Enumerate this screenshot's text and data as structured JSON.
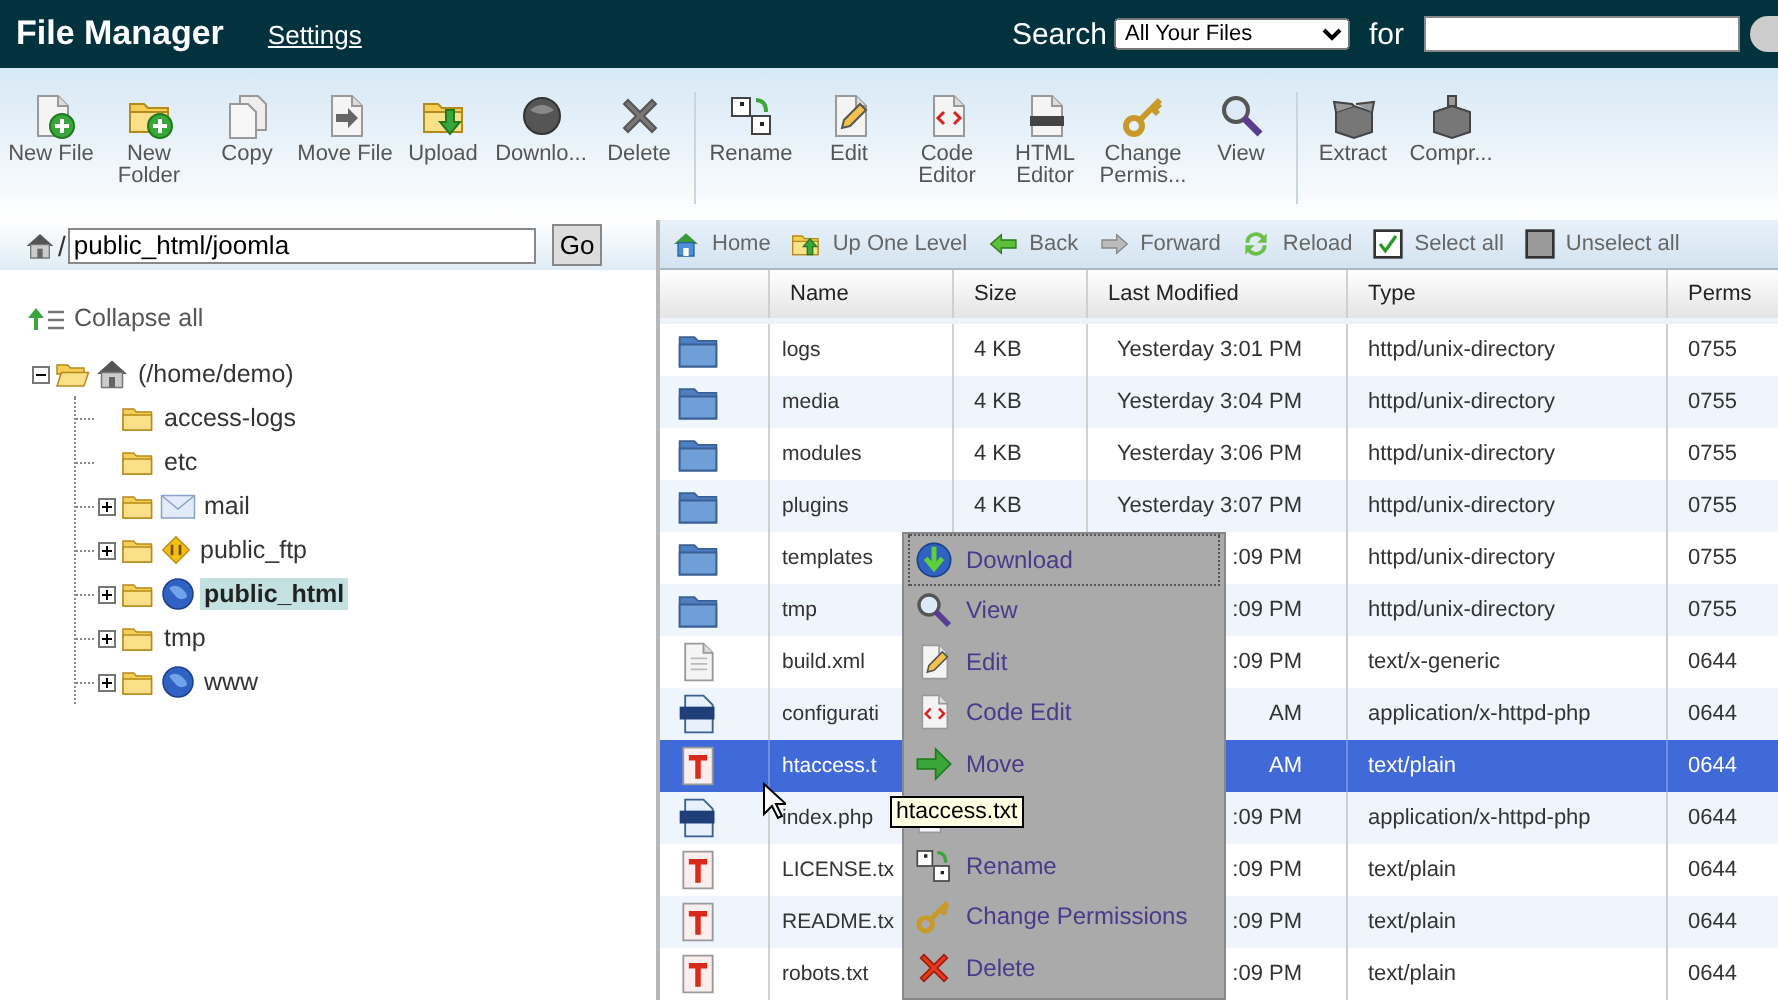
{
  "header": {
    "title": "File Manager",
    "settings_link": "Settings",
    "search_label": "Search",
    "search_scope": "All Your Files",
    "for_label": "for"
  },
  "toolbar": {
    "groups": [
      [
        {
          "label": "New File",
          "kind": "newfile"
        },
        {
          "label": "New Folder",
          "kind": "newfolder"
        },
        {
          "label": "Copy",
          "kind": "copy"
        },
        {
          "label": "Move File",
          "kind": "move"
        },
        {
          "label": "Upload",
          "kind": "upload"
        },
        {
          "label": "Downlo...",
          "kind": "download"
        },
        {
          "label": "Delete",
          "kind": "delete"
        }
      ],
      [
        {
          "label": "Rename",
          "kind": "rename"
        },
        {
          "label": "Edit",
          "kind": "edit"
        },
        {
          "label": "Code Editor",
          "kind": "code"
        },
        {
          "label": "HTML Editor",
          "kind": "html"
        },
        {
          "label": "Change Permis...",
          "kind": "key"
        },
        {
          "label": "View",
          "kind": "search"
        }
      ],
      [
        {
          "label": "Extract",
          "kind": "extract"
        },
        {
          "label": "Compr...",
          "kind": "compress"
        }
      ]
    ]
  },
  "location": {
    "root": "/",
    "path": "public_html/joomla",
    "go": "Go"
  },
  "tree": {
    "collapse_all": "Collapse all",
    "nodes": [
      {
        "label": "(/home/demo)",
        "kind": "home",
        "expanded": true,
        "selected": false,
        "children": [
          {
            "label": "access-logs",
            "kind": "folder",
            "selected": false
          },
          {
            "label": "etc",
            "kind": "folder",
            "selected": false
          },
          {
            "label": "mail",
            "kind": "mail",
            "expanded": false,
            "selected": false
          },
          {
            "label": "public_ftp",
            "kind": "ftp",
            "expanded": false,
            "selected": false
          },
          {
            "label": "public_html",
            "kind": "web",
            "expanded": false,
            "selected": true
          },
          {
            "label": "tmp",
            "kind": "folder",
            "expanded": false,
            "selected": false
          },
          {
            "label": "www",
            "kind": "web",
            "expanded": false,
            "selected": false
          }
        ]
      }
    ]
  },
  "nav": [
    {
      "label": "Home",
      "kind": "home"
    },
    {
      "label": "Up One Level",
      "kind": "up"
    },
    {
      "label": "Back",
      "kind": "back"
    },
    {
      "label": "Forward",
      "kind": "forward"
    },
    {
      "label": "Reload",
      "kind": "reload"
    },
    {
      "label": "Select all",
      "kind": "check"
    },
    {
      "label": "Unselect all",
      "kind": "uncheck"
    }
  ],
  "table": {
    "columns": [
      "Name",
      "Size",
      "Last Modified",
      "Type",
      "Perms"
    ],
    "rows": [
      {
        "kind": "folder",
        "name": "logs",
        "size": "4 KB",
        "modified": "Yesterday 3:01 PM",
        "type": "httpd/unix-directory",
        "perms": "0755",
        "selected": false
      },
      {
        "kind": "folder",
        "name": "media",
        "size": "4 KB",
        "modified": "Yesterday 3:04 PM",
        "type": "httpd/unix-directory",
        "perms": "0755",
        "selected": false
      },
      {
        "kind": "folder",
        "name": "modules",
        "size": "4 KB",
        "modified": "Yesterday 3:06 PM",
        "type": "httpd/unix-directory",
        "perms": "0755",
        "selected": false
      },
      {
        "kind": "folder",
        "name": "plugins",
        "size": "4 KB",
        "modified": "Yesterday 3:07 PM",
        "type": "httpd/unix-directory",
        "perms": "0755",
        "selected": false
      },
      {
        "kind": "folder",
        "name": "templates",
        "modified": ":09 PM",
        "type": "httpd/unix-directory",
        "perms": "0755",
        "selected": false
      },
      {
        "kind": "folder",
        "name": "tmp",
        "modified": ":09 PM",
        "type": "httpd/unix-directory",
        "perms": "0755",
        "selected": false
      },
      {
        "kind": "generic",
        "name": "build.xml",
        "modified": ":09 PM",
        "type": "text/x-generic",
        "perms": "0644",
        "selected": false
      },
      {
        "kind": "php",
        "name": "configurati",
        "modified": "AM",
        "type": "application/x-httpd-php",
        "perms": "0644",
        "selected": false
      },
      {
        "kind": "text",
        "name": "htaccess.t",
        "modified": "AM",
        "type": "text/plain",
        "perms": "0644",
        "selected": true
      },
      {
        "kind": "php",
        "name": "index.php",
        "modified": ":09 PM",
        "type": "application/x-httpd-php",
        "perms": "0644",
        "selected": false
      },
      {
        "kind": "text",
        "name": "LICENSE.tx",
        "modified": ":09 PM",
        "type": "text/plain",
        "perms": "0644",
        "selected": false
      },
      {
        "kind": "text",
        "name": "README.tx",
        "modified": ":09 PM",
        "type": "text/plain",
        "perms": "0644",
        "selected": false
      },
      {
        "kind": "text",
        "name": "robots.txt",
        "modified": ":09 PM",
        "type": "text/plain",
        "perms": "0644",
        "selected": false
      }
    ]
  },
  "context_menu": [
    {
      "label": "Download",
      "kind": "download",
      "focused": true
    },
    {
      "label": "View",
      "kind": "search",
      "focused": false
    },
    {
      "label": "Edit",
      "kind": "edit",
      "focused": false
    },
    {
      "label": "Code Edit",
      "kind": "code",
      "focused": false
    },
    {
      "label": "Move",
      "kind": "move",
      "focused": false
    },
    {
      "kind": "copy"
    },
    {
      "label": "Rename",
      "kind": "rename",
      "focused": false
    },
    {
      "label": "Change Permissions",
      "kind": "key",
      "focused": false
    },
    {
      "label": "Delete",
      "kind": "delete",
      "focused": false
    }
  ],
  "tooltip": "htaccess.txt"
}
